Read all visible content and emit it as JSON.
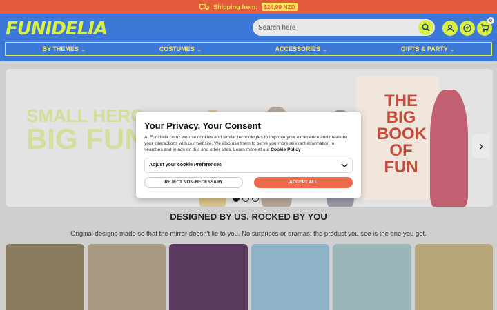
{
  "topbar": {
    "shipping_label": "Shipping from:",
    "shipping_price": "$24,99 NZD",
    "icon": "truck-icon"
  },
  "header": {
    "logo": "FUNIDELIA",
    "search": {
      "placeholder": "Search here",
      "icon": "search-icon"
    },
    "icons": [
      "account-icon",
      "help-icon",
      "cart-icon"
    ],
    "cart_count": "0"
  },
  "nav": {
    "items": [
      {
        "label": "BY THEMES"
      },
      {
        "label": "COSTUMES"
      },
      {
        "label": "ACCESSORIES"
      },
      {
        "label": "GIFTS & PARTY"
      }
    ]
  },
  "hero": {
    "line1": "SMALL HERO",
    "line2": "BIG FUN",
    "book_title": "THE BIG BOOK OF FUN"
  },
  "carousel": {
    "slides": 3,
    "active": 1
  },
  "section": {
    "title": "DESIGNED BY US. ROCKED BY YOU",
    "subtitle": "Original designs made so that the mirror doesn't lie to you. No surprises or dramas: the product you see is the one you get."
  },
  "consent": {
    "title": "Your Privacy, Your Consent",
    "body": "At Funidelia.co.nz we use cookies and similar technologies to improve your experience and measure your interactions with our website. We also use them to serve you more relevant information in searches and in ads on this and other sites. Learn more at our",
    "link": "Cookie Policy",
    "preferences_label": "Adjust your cookie Preferences",
    "reject_label": "REJECT NON-NECESSARY",
    "accept_label": "ACCEPT ALL"
  },
  "colors": {
    "brand_blue": "#3c78d8",
    "brand_lime": "#d8f041",
    "topbar": "#e35d3c",
    "accept": "#ee6a4c"
  }
}
